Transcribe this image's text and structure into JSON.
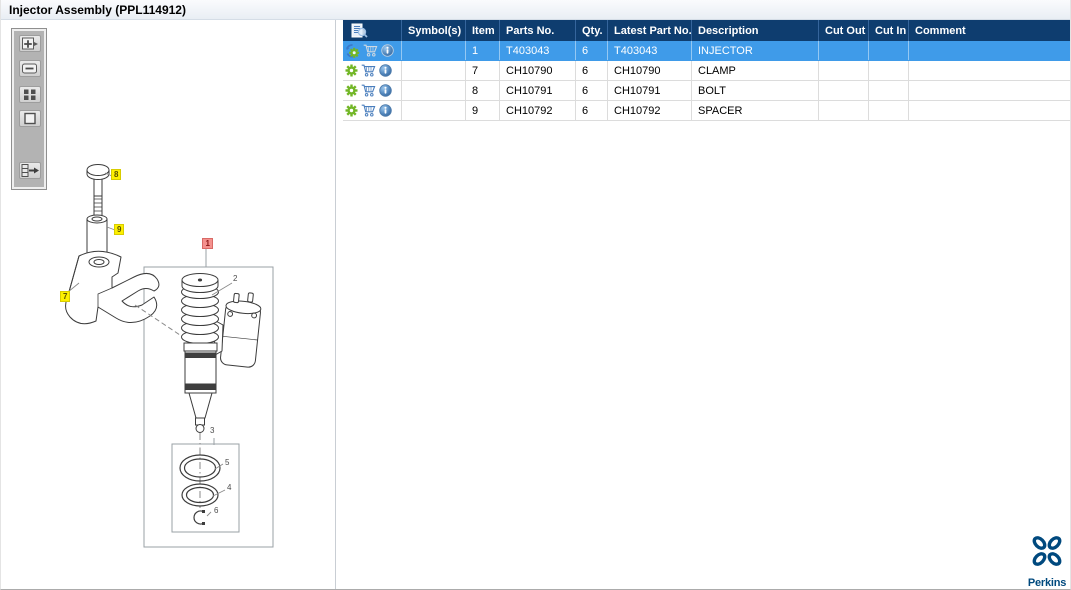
{
  "window": {
    "title": "Injector Assembly (PPL114912)"
  },
  "toolbar": {
    "buttons": [
      {
        "icon": "zoom-in-icon"
      },
      {
        "icon": "zoom-out-icon"
      },
      {
        "icon": "zoom-region-icon"
      },
      {
        "icon": "fit-page-icon"
      },
      {
        "icon": "toggle-panel-icon"
      }
    ]
  },
  "diagram": {
    "callouts": [
      {
        "n": "1",
        "highlight": "selected"
      },
      {
        "n": "2",
        "highlight": "none"
      },
      {
        "n": "3",
        "highlight": "none"
      },
      {
        "n": "4",
        "highlight": "none"
      },
      {
        "n": "5",
        "highlight": "none"
      },
      {
        "n": "6",
        "highlight": "none"
      },
      {
        "n": "7",
        "highlight": "match"
      },
      {
        "n": "8",
        "highlight": "match"
      },
      {
        "n": "9",
        "highlight": "match"
      }
    ]
  },
  "table": {
    "columns": {
      "tools": "",
      "symbols": "Symbol(s)",
      "item": "Item",
      "parts_no": "Parts No.",
      "qty": "Qty.",
      "latest_part_no": "Latest Part No.",
      "description": "Description",
      "cut_out": "Cut Out",
      "cut_in": "Cut In",
      "comment": "Comment"
    },
    "rows": [
      {
        "symbols": "",
        "item": "1",
        "parts_no": "T403043",
        "qty": "6",
        "latest_part_no": "T403043",
        "description": "INJECTOR",
        "cut_out": "",
        "cut_in": "",
        "comment": ""
      },
      {
        "symbols": "",
        "item": "7",
        "parts_no": "CH10790",
        "qty": "6",
        "latest_part_no": "CH10790",
        "description": "CLAMP",
        "cut_out": "",
        "cut_in": "",
        "comment": ""
      },
      {
        "symbols": "",
        "item": "8",
        "parts_no": "CH10791",
        "qty": "6",
        "latest_part_no": "CH10791",
        "description": "BOLT",
        "cut_out": "",
        "cut_in": "",
        "comment": ""
      },
      {
        "symbols": "",
        "item": "9",
        "parts_no": "CH10792",
        "qty": "6",
        "latest_part_no": "CH10792",
        "description": "SPACER",
        "cut_out": "",
        "cut_in": "",
        "comment": ""
      }
    ]
  },
  "logo": {
    "brand": "Perkins"
  },
  "colors": {
    "header_bg": "#0e3d6f",
    "selected_row": "#3f9be9",
    "gear_green": "#72b626",
    "cart_blue": "#4a7ebd",
    "callout_match_bg": "#fdf000",
    "callout_selected_bg": "#f4918e",
    "logo_blue": "#00497e"
  }
}
